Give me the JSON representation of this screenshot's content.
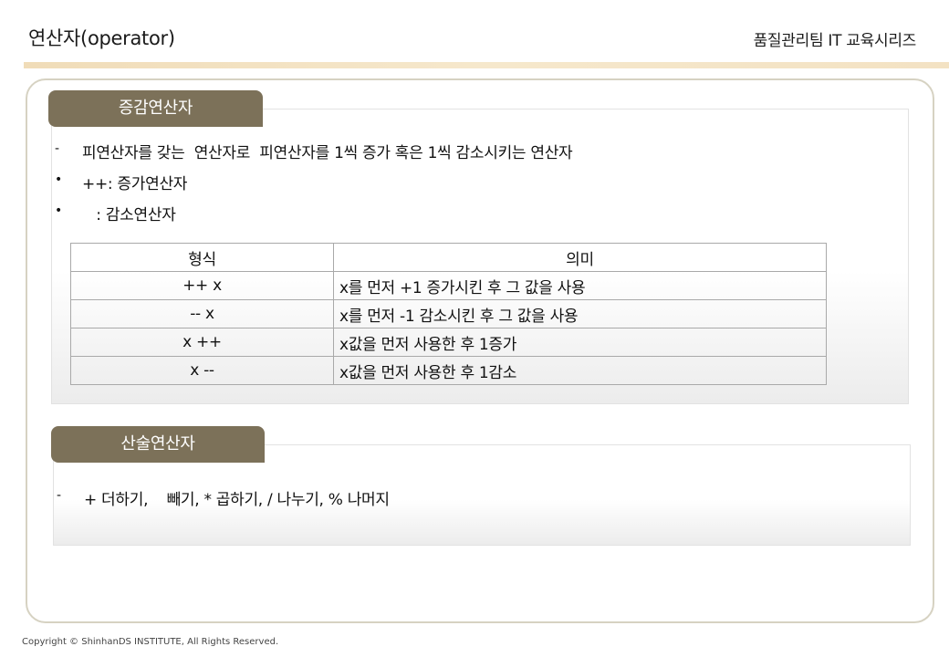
{
  "header": {
    "title": "연산자(operator)",
    "series": "품질관리팀 IT 교육시리즈"
  },
  "section_increment": {
    "tab_label": "증감연산자",
    "lines": [
      {
        "marker": "-",
        "text": "피연산자를 갖는  연산자로  피연산자를 1씩 증가 혹은 1씩 감소시키는 연산자"
      },
      {
        "marker": "•",
        "text": "++: 증가연산자"
      },
      {
        "marker": "•",
        "text": "   : 감소연산자"
      }
    ],
    "table": {
      "headers": [
        "형식",
        "의미"
      ],
      "rows": [
        [
          "++ x",
          "x를 먼저 +1 증가시킨 후 그 값을 사용"
        ],
        [
          "-- x",
          "x를 먼저 -1 감소시킨 후 그 값을 사용"
        ],
        [
          "x ++",
          "x값을 먼저 사용한 후 1증가"
        ],
        [
          "x --",
          "x값을 먼저 사용한 후 1감소"
        ]
      ]
    }
  },
  "section_arithmetic": {
    "tab_label": "산술연산자",
    "line": {
      "marker": "-",
      "text": "+ 더하기,    빼기, * 곱하기, / 나누기, % 나머지"
    }
  },
  "footer": {
    "copyright": "Copyright © ShinhanDS INSTITUTE, All Rights Reserved."
  }
}
